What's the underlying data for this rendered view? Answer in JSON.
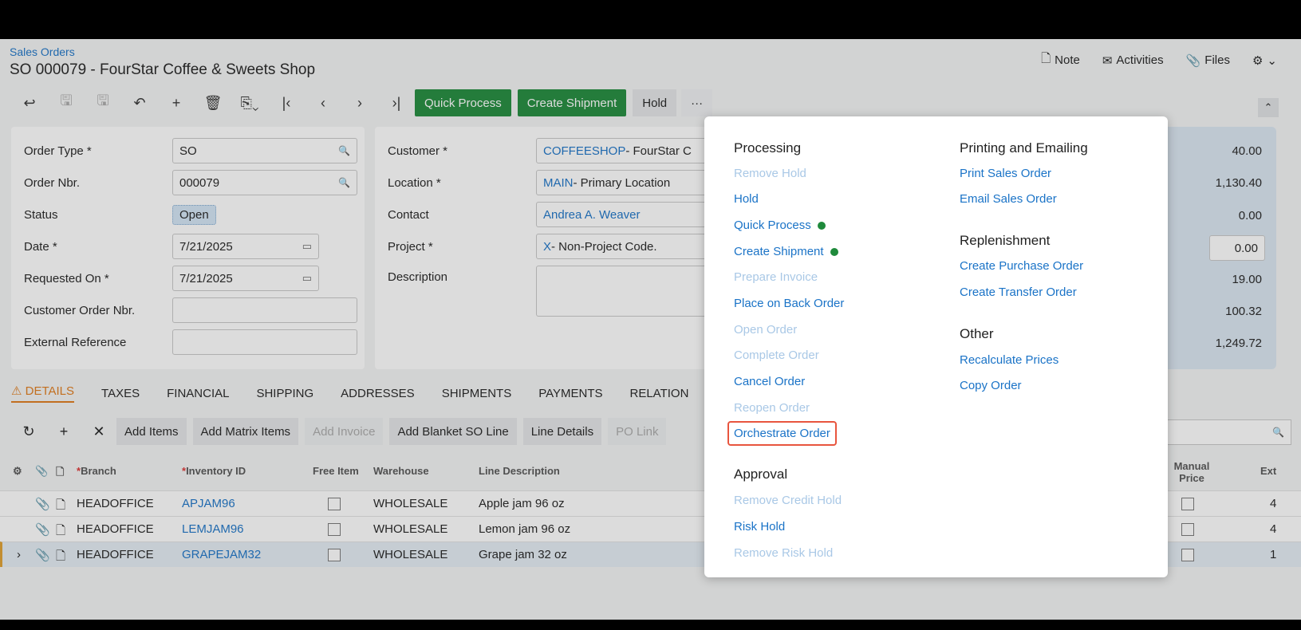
{
  "header": {
    "breadcrumb": "Sales Orders",
    "title": "SO 000079 - FourStar Coffee & Sweets Shop",
    "actions": [
      "Note",
      "Activities",
      "Files"
    ]
  },
  "toolbar": {
    "quick_process": "Quick Process",
    "create_shipment": "Create Shipment",
    "hold": "Hold",
    "more": "···"
  },
  "form": {
    "order_type_label": "Order Type *",
    "order_type": "SO",
    "order_nbr_label": "Order Nbr.",
    "order_nbr": "000079",
    "status_label": "Status",
    "status": "Open",
    "date_label": "Date *",
    "date": "7/21/2025",
    "requested_on_label": "Requested On *",
    "requested_on": "7/21/2025",
    "customer_order_nbr_label": "Customer Order Nbr.",
    "external_reference_label": "External Reference",
    "customer_label": "Customer *",
    "customer_code": "COFFEESHOP",
    "customer_name": " - FourStar C",
    "location_label": "Location *",
    "location_code": "MAIN",
    "location_name": " - Primary Location",
    "contact_label": "Contact",
    "contact": "Andrea A. Weaver",
    "project_label": "Project *",
    "project_code": "X",
    "project_name": " - Non-Project Code.",
    "description_label": "Description"
  },
  "summary": {
    "values": [
      "40.00",
      "1,130.40",
      "0.00",
      "0.00",
      "19.00",
      "100.32",
      "1,249.72"
    ]
  },
  "tabs": [
    "DETAILS",
    "TAXES",
    "FINANCIAL",
    "SHIPPING",
    "ADDRESSES",
    "SHIPMENTS",
    "PAYMENTS",
    "RELATION"
  ],
  "grid_toolbar": {
    "add_items": "Add Items",
    "add_matrix_items": "Add Matrix Items",
    "add_invoice": "Add Invoice",
    "add_blanket": "Add Blanket SO Line",
    "line_details": "Line Details",
    "po_link": "PO Link"
  },
  "grid": {
    "columns": {
      "branch": "Branch",
      "inventory_id": "Inventory ID",
      "free_item": "Free Item",
      "warehouse": "Warehouse",
      "line_description": "Line Description",
      "manual_price": "Manual Price",
      "ext": "Ext"
    },
    "rows": [
      {
        "branch": "HEADOFFICE",
        "inventory_id": "APJAM96",
        "warehouse": "WHOLESALE",
        "description": "Apple jam 96 oz",
        "ext": "4"
      },
      {
        "branch": "HEADOFFICE",
        "inventory_id": "LEMJAM96",
        "warehouse": "WHOLESALE",
        "description": "Lemon jam 96 oz",
        "ext": "4"
      },
      {
        "branch": "HEADOFFICE",
        "inventory_id": "GRAPEJAM32",
        "warehouse": "WHOLESALE",
        "description": "Grape jam 32 oz",
        "ext": "1"
      }
    ]
  },
  "menu": {
    "processing": {
      "heading": "Processing",
      "items": [
        "Remove Hold",
        "Hold",
        "Quick Process",
        "Create Shipment",
        "Prepare Invoice",
        "Place on Back Order",
        "Open Order",
        "Complete Order",
        "Cancel Order",
        "Reopen Order",
        "Orchestrate Order"
      ]
    },
    "approval": {
      "heading": "Approval",
      "items": [
        "Remove Credit Hold",
        "Risk Hold",
        "Remove Risk Hold"
      ]
    },
    "printing": {
      "heading": "Printing and Emailing",
      "items": [
        "Print Sales Order",
        "Email Sales Order"
      ]
    },
    "replenishment": {
      "heading": "Replenishment",
      "items": [
        "Create Purchase Order",
        "Create Transfer Order"
      ]
    },
    "other": {
      "heading": "Other",
      "items": [
        "Recalculate Prices",
        "Copy Order"
      ]
    }
  }
}
